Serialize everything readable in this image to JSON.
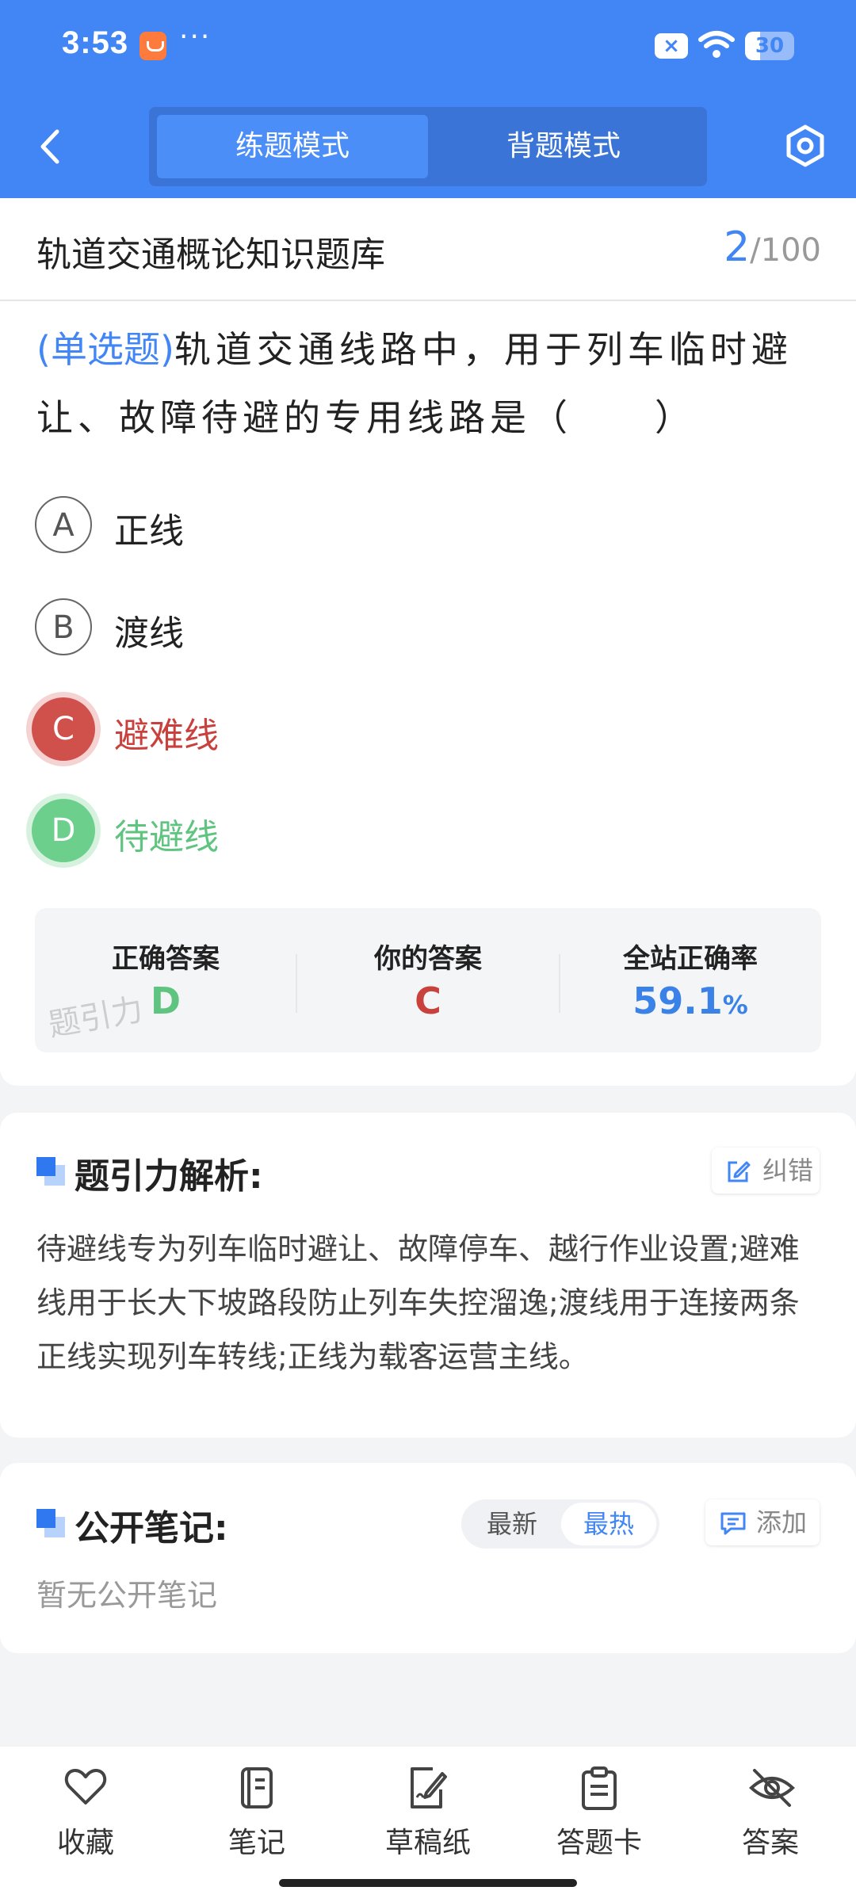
{
  "status_bar": {
    "time": "3:53",
    "more": "···",
    "battery": "30"
  },
  "nav": {
    "back_icon": "chevron-left-icon",
    "tabs": [
      {
        "label": "练题模式",
        "active": true
      },
      {
        "label": "背题模式",
        "active": false
      }
    ],
    "settings_icon": "hexagon-settings-icon"
  },
  "question_card": {
    "bank_title": "轨道交通概论知识题库",
    "progress": {
      "current": "2",
      "total": "/100"
    },
    "question_type": "(单选题)",
    "question_text": "轨道交通线路中，用于列车临时避让、故障待避的专用线路是（　　）",
    "options": [
      {
        "letter": "A",
        "text": "正线",
        "state": "normal"
      },
      {
        "letter": "B",
        "text": "渡线",
        "state": "normal"
      },
      {
        "letter": "C",
        "text": "避难线",
        "state": "wrong"
      },
      {
        "letter": "D",
        "text": "待避线",
        "state": "correct"
      }
    ],
    "stats": {
      "correct_label": "正确答案",
      "correct_value": "D",
      "yours_label": "你的答案",
      "yours_value": "C",
      "rate_label": "全站正确率",
      "rate_value": "59.1",
      "rate_unit": "%"
    },
    "watermark": "题引力"
  },
  "analysis": {
    "title": "题引力解析:",
    "report_button": "纠错",
    "text": "待避线专为列车临时避让、故障停车、越行作业设置;避难线用于长大下坡路段防止列车失控溜逸;渡线用于连接两条正线实现列车转线;正线为载客运营主线。"
  },
  "notes": {
    "title": "公开笔记:",
    "sort_latest": "最新",
    "sort_hot": "最热",
    "sort_selected": "最热",
    "add_button": "添加",
    "empty": "暂无公开笔记"
  },
  "bottom_bar": [
    {
      "label": "收藏",
      "icon": "heart-icon"
    },
    {
      "label": "笔记",
      "icon": "notebook-icon"
    },
    {
      "label": "草稿纸",
      "icon": "draft-paper-icon"
    },
    {
      "label": "答题卡",
      "icon": "answer-sheet-icon"
    },
    {
      "label": "答案",
      "icon": "eye-off-icon"
    }
  ],
  "colors": {
    "primary": "#4285f4",
    "wrong": "#d0504c",
    "correct": "#6dcf8c",
    "background": "#f3f4f6"
  }
}
